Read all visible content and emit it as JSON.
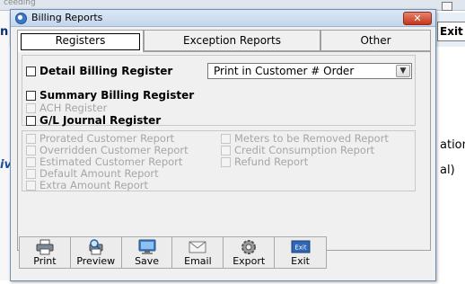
{
  "background": {
    "title_fragment": "ceeding",
    "left_fragment_1": "n",
    "left_fragment_2": "iv",
    "right_button": "Exit",
    "right_fragment_1": "ationa",
    "right_fragment_2": "al)"
  },
  "window": {
    "title": "Billing Reports",
    "close_glyph": "✕"
  },
  "tabs": [
    {
      "label": "Registers",
      "active": true
    },
    {
      "label": "Exception Reports",
      "active": false
    },
    {
      "label": "Other",
      "active": false
    }
  ],
  "registers": {
    "detail_billing": "Detail Billing Register",
    "sort_select_value": "Print in Customer # Order",
    "summary_billing": "Summary Billing Register",
    "ach_register": "ACH Register",
    "gl_journal": "G/L Journal Register"
  },
  "reports_left": [
    "Prorated Customer Report",
    "Overridden Customer Report",
    "Estimated Customer Report",
    "Default Amount Report",
    "Extra Amount Report"
  ],
  "reports_right": [
    "Meters to be Removed Report",
    "Credit Consumption Report",
    "Refund Report"
  ],
  "toolbar": [
    {
      "label": "Print",
      "icon": "printer-icon"
    },
    {
      "label": "Preview",
      "icon": "print-preview-icon"
    },
    {
      "label": "Save",
      "icon": "monitor-save-icon"
    },
    {
      "label": "Email",
      "icon": "envelope-icon"
    },
    {
      "label": "Export",
      "icon": "gear-export-icon"
    },
    {
      "label": "Exit",
      "icon": "exit-sign-icon",
      "icon_text": "Exit"
    }
  ]
}
